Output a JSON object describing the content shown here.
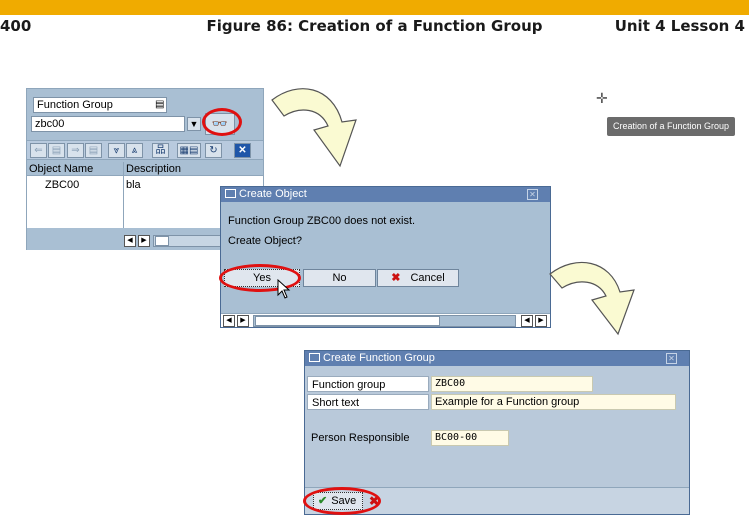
{
  "header": {
    "page_number": "400",
    "figure_title": "Figure 86: Creation of a Function Group",
    "unit_lesson": "Unit 4 Lesson 4"
  },
  "colors": {
    "accent_bar": "#f0ab00",
    "callout": "#e01010",
    "sap_bg": "#a9bfd3"
  },
  "tooltip": "Creation of a Function Group",
  "panel1": {
    "object_type": "Function Group",
    "input_value": "zbc00",
    "toolbar_icons": [
      "back-icon",
      "doc-icon",
      "forward-icon",
      "doc-icon",
      "collapse-icon",
      "expand-icon",
      "hierarchy-icon",
      "grid-icon",
      "refresh-icon",
      "close-icon"
    ],
    "columns": [
      "Object Name",
      "Description"
    ],
    "rows": [
      {
        "name": "ZBC00",
        "description": "bla"
      }
    ]
  },
  "panel2": {
    "title": "Create Object",
    "message1": "Function Group ZBC00 does not exist.",
    "message2": "Create Object?",
    "yes_label": "Yes",
    "no_label": "No",
    "cancel_label": "Cancel"
  },
  "panel3": {
    "title": "Create Function Group",
    "function_group_label": "Function group",
    "function_group_value": "ZBC00",
    "short_text_label": "Short text",
    "short_text_value": "Example for a Function group",
    "person_label": "Person Responsible",
    "person_value": "BC00-00",
    "save_label": "Save"
  }
}
